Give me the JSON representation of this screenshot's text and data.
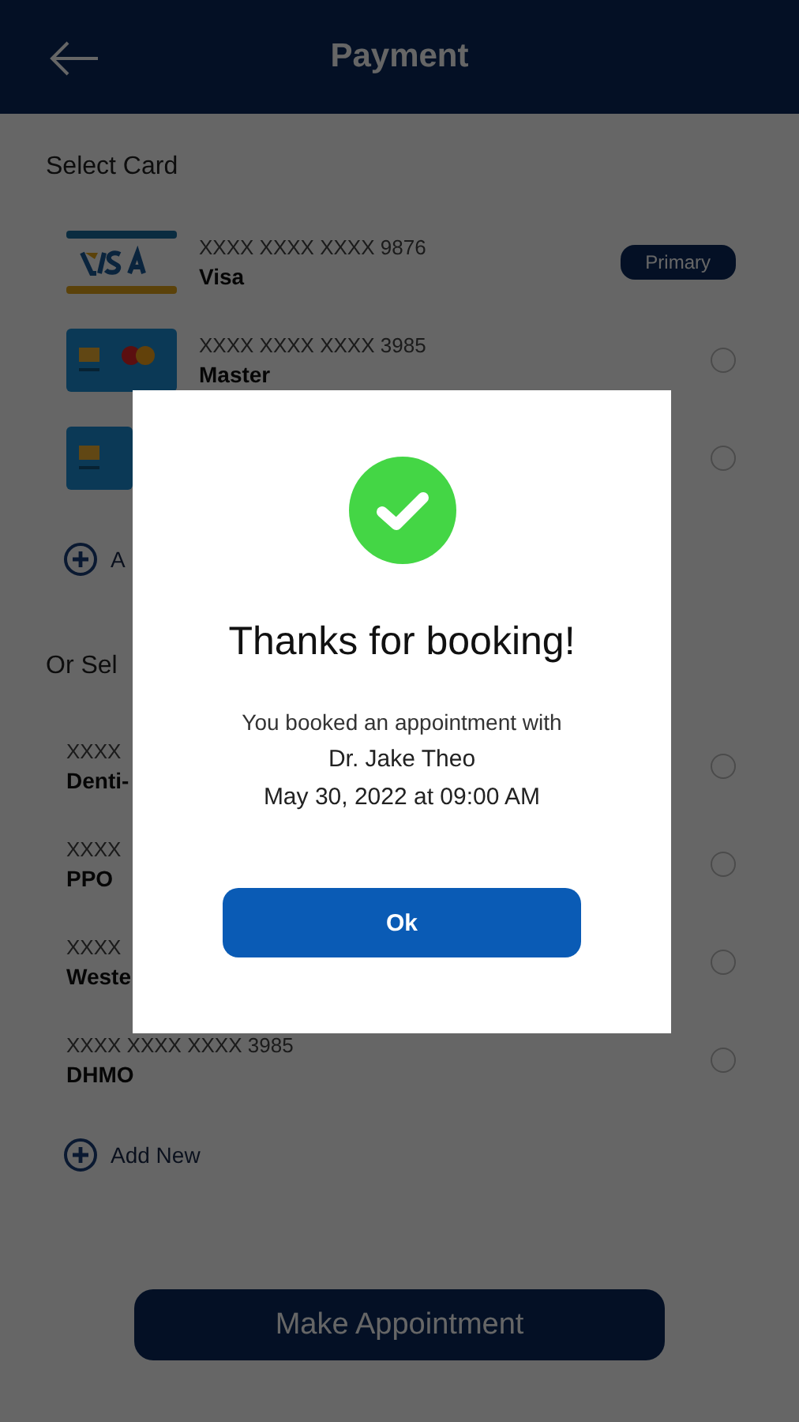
{
  "header": {
    "title": "Payment"
  },
  "card_section": {
    "label": "Select Card",
    "cards": [
      {
        "kind": "visa",
        "number": "XXXX XXXX XXXX 9876",
        "name": "Visa",
        "badge": "Primary"
      },
      {
        "kind": "master",
        "number": "XXXX XXXX XXXX 3985",
        "name": "Master",
        "selected": false
      },
      {
        "kind": "card_edge",
        "selected": false
      }
    ],
    "add_label": "A"
  },
  "insurance_section": {
    "label": "Or Sel",
    "plans": [
      {
        "number": "XXXX",
        "name": "Denti-",
        "selected": false
      },
      {
        "number": "XXXX",
        "name": "PPO",
        "selected": false
      },
      {
        "number": "XXXX",
        "name": "Weste",
        "selected": false
      },
      {
        "number": "XXXX XXXX XXXX 3985",
        "name": "DHMO",
        "selected": false
      }
    ],
    "add_label": "Add New"
  },
  "primary_button": "Make Appointment",
  "dialog": {
    "title": "Thanks for booking!",
    "message": "You booked an appointment with",
    "doctor": "Dr. Jake Theo",
    "when": "May 30, 2022 at 09:00 AM",
    "button": "Ok"
  }
}
